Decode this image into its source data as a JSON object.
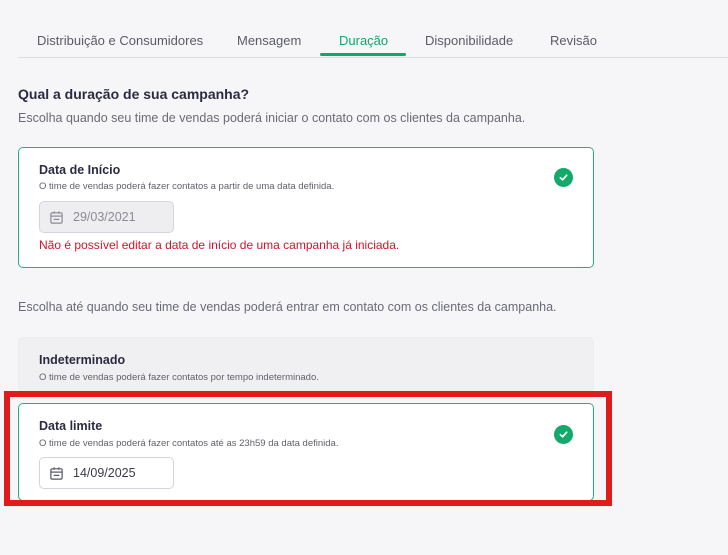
{
  "tabs": [
    {
      "label": "Distribuição e Consumidores"
    },
    {
      "label": "Mensagem"
    },
    {
      "label": "Duração"
    },
    {
      "label": "Disponibilidade"
    },
    {
      "label": "Revisão"
    }
  ],
  "active_tab": "Duração",
  "main": {
    "title": "Qual a duração de sua campanha?",
    "subtitle": "Escolha quando seu time de vendas poderá iniciar o contato com os clientes da campanha.",
    "subtitle_end": "Escolha até quando seu time de vendas poderá entrar em contato com os clientes da campanha."
  },
  "start_card": {
    "title": "Data de Início",
    "description": "O time de vendas poderá fazer contatos a partir de uma data definida.",
    "date_value": "29/03/2021",
    "error": "Não é possível editar a data de início de uma campanha já iniciada.",
    "icon": "check-circle-icon"
  },
  "undetermined_card": {
    "title": "Indeterminado",
    "description": "O time de vendas poderá fazer contatos por tempo indeterminado."
  },
  "deadline_card": {
    "title": "Data limite",
    "description": "O time de vendas poderá fazer contatos até as 23h59 da data definida.",
    "date_value": "14/09/2025",
    "icon": "check-circle-icon"
  },
  "colors": {
    "accent": "#11a66b",
    "error": "#d0142b",
    "highlight": "#e01b1b"
  }
}
